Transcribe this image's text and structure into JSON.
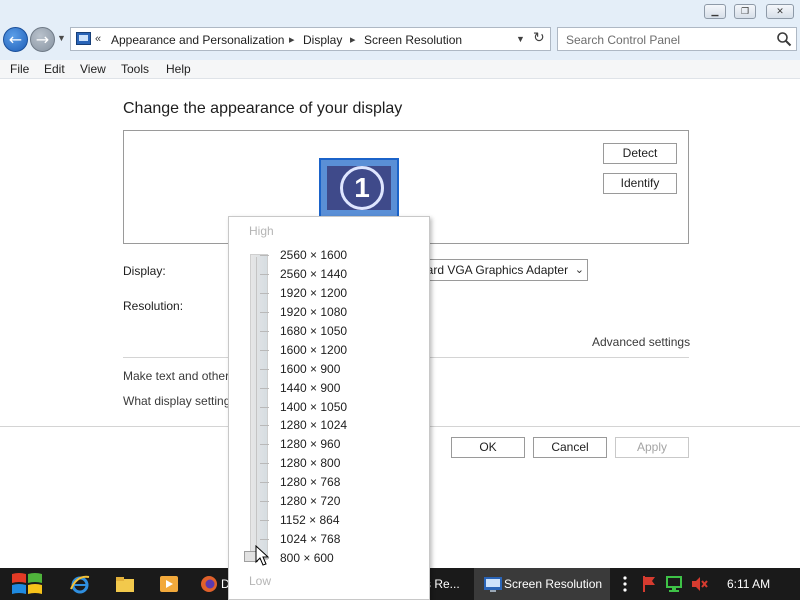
{
  "window": {
    "min_glyph": "▁",
    "max_glyph": "❐",
    "close_glyph": "✕"
  },
  "nav": {
    "back_glyph": "←",
    "forward_glyph": "→",
    "recent_glyph": "▼",
    "crumb_prefix": "«",
    "breadcrumbs": [
      "Appearance and Personalization",
      "Display",
      "Screen Resolution"
    ],
    "sep_glyph": "▸",
    "dropdown_glyph": "▼",
    "refresh_glyph": "↻"
  },
  "search": {
    "placeholder": "Search Control Panel"
  },
  "menu": [
    "File",
    "Edit",
    "View",
    "Tools",
    "Help"
  ],
  "main": {
    "heading": "Change the appearance of your display",
    "monitor_number": "1",
    "detect_label": "Detect",
    "identify_label": "Identify",
    "display_label": "Display:",
    "display_value": "lard VGA Graphics Adapter",
    "display_chev": "⌄",
    "resolution_label": "Resolution:",
    "advanced_settings": "Advanced settings",
    "text_size_link": "Make text and other",
    "settings_link": "What display setting",
    "ok_label": "OK",
    "cancel_label": "Cancel",
    "apply_label": "Apply"
  },
  "resolution_popup": {
    "high_label": "High",
    "low_label": "Low",
    "options": [
      "2560 × 1600",
      "2560 × 1440",
      "1920 × 1200",
      "1920 × 1080",
      "1680 × 1050",
      "1600 × 1200",
      "1600 × 900",
      "1440 × 900",
      "1400 × 1050",
      "1280 × 1024",
      "1280 × 960",
      "1280 × 800",
      "1280 × 768",
      "1280 × 720",
      "1152 × 864",
      "1024 × 768",
      "800 × 600"
    ],
    "selected": "800 × 600"
  },
  "taskbar": {
    "partial_label_left": "D",
    "partial_label_right": "s Re...",
    "active_label": "Screen Resolution",
    "clock": "6:11 AM"
  },
  "colors": {
    "accent": "#1b63c9",
    "taskbar": "#1a1a1a",
    "chrome": "#e4eef8"
  }
}
